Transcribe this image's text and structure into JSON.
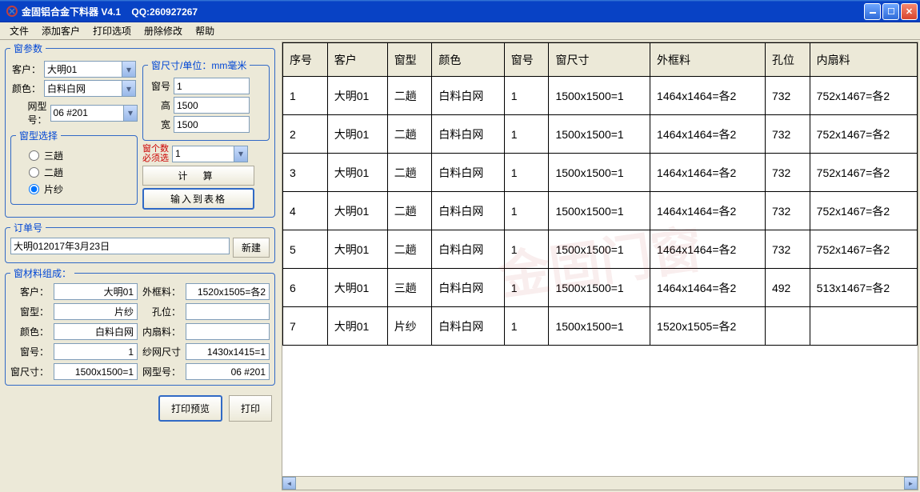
{
  "window": {
    "title": "金固铝合金下料器  V4.1",
    "qq": "QQ:260927267"
  },
  "menu": [
    "文件",
    "添加客户",
    "打印选项",
    "册除修改",
    "帮助"
  ],
  "params": {
    "legend": "窗参数",
    "customer_label": "客户：",
    "customer_value": "大明01",
    "color_label": "颜色：",
    "color_value": "白料白网",
    "mesh_label": "网型号：",
    "mesh_value": "06 #201",
    "sizes_legend": "窗尺寸/单位：mm毫米",
    "winno_label": "窗号",
    "winno_value": "1",
    "height_label": "高",
    "height_value": "1500",
    "width_label": "宽",
    "width_value": "1500",
    "count_label_1": "窗个数",
    "count_label_2": "必须选",
    "count_value": "1",
    "type_legend": "窗型选择",
    "type_options": [
      "三趟",
      "二趟",
      "片纱"
    ],
    "type_selected": 2,
    "calc_btn": "计    算",
    "input_btn": "输入到表格"
  },
  "order": {
    "legend": "订单号",
    "value": "大明012017年3月23日",
    "new_btn": "新建"
  },
  "material": {
    "legend": "窗材料组成：",
    "customer_label": "客户：",
    "customer_value": "大明01",
    "frame_label": "外框料：",
    "frame_value": "1520x1505=各2",
    "type_label": "窗型：",
    "type_value": "片纱",
    "hole_label": "孔位：",
    "hole_value": "",
    "color_label": "颜色：",
    "color_value": "白料白网",
    "inner_label": "内扇料：",
    "inner_value": "",
    "winno_label": "窗号：",
    "winno_value": "1",
    "mesh_label": "纱网尺寸",
    "mesh_value": "1430x1415=1",
    "size_label": "窗尺寸：",
    "size_value": "1500x1500=1",
    "model_label": "网型号：",
    "model_value": "06 #201"
  },
  "print": {
    "preview_btn": "打印预览",
    "print_btn": "打印"
  },
  "table": {
    "headers": [
      "序号",
      "客户",
      "窗型",
      "颜色",
      "窗号",
      "窗尺寸",
      "外框料",
      "孔位",
      "内扇料"
    ],
    "rows": [
      [
        "1",
        "大明01",
        "二趟",
        "白料白网",
        "1",
        "1500x1500=1",
        "1464x1464=各2",
        "732",
        "752x1467=各2"
      ],
      [
        "2",
        "大明01",
        "二趟",
        "白料白网",
        "1",
        "1500x1500=1",
        "1464x1464=各2",
        "732",
        "752x1467=各2"
      ],
      [
        "3",
        "大明01",
        "二趟",
        "白料白网",
        "1",
        "1500x1500=1",
        "1464x1464=各2",
        "732",
        "752x1467=各2"
      ],
      [
        "4",
        "大明01",
        "二趟",
        "白料白网",
        "1",
        "1500x1500=1",
        "1464x1464=各2",
        "732",
        "752x1467=各2"
      ],
      [
        "5",
        "大明01",
        "二趟",
        "白料白网",
        "1",
        "1500x1500=1",
        "1464x1464=各2",
        "732",
        "752x1467=各2"
      ],
      [
        "6",
        "大明01",
        "三趟",
        "白料白网",
        "1",
        "1500x1500=1",
        "1464x1464=各2",
        "492",
        "513x1467=各2"
      ],
      [
        "7",
        "大明01",
        "片纱",
        "白料白网",
        "1",
        "1500x1500=1",
        "1520x1505=各2",
        "",
        ""
      ]
    ]
  },
  "watermark": "金固门窗"
}
